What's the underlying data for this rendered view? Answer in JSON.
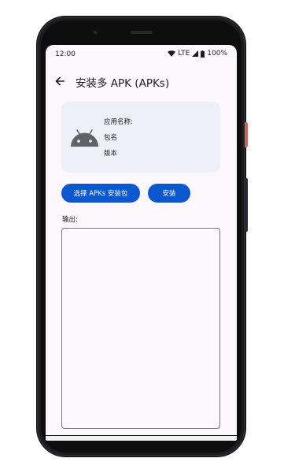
{
  "status_bar": {
    "time": "12:00",
    "network": "LTE",
    "battery": "100%",
    "icons": [
      "wifi-icon",
      "signal-icon",
      "battery-icon"
    ]
  },
  "app_bar": {
    "back_icon": "arrow-back-icon",
    "title": "安装多 APK (APKs)"
  },
  "info_card": {
    "icon": "android-icon",
    "app_name_label": "应用名称:",
    "package_label": "包名",
    "version_label": "版本"
  },
  "actions": {
    "select_label": "选择 APKs 安装包",
    "install_label": "安装"
  },
  "output": {
    "label": "输出:",
    "value": ""
  },
  "colors": {
    "primary": "#0b57d0",
    "screen_background": "#fdf8fd",
    "card_background": "#eef0f9",
    "text": "#1d1b20"
  }
}
